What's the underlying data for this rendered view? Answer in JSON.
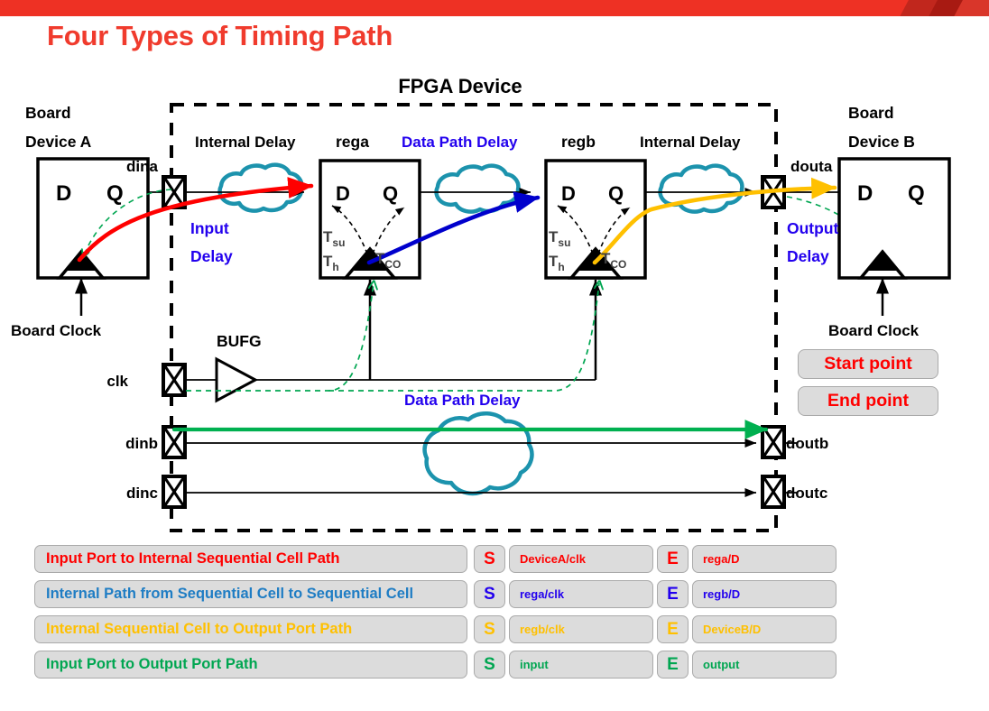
{
  "title": "Four Types of Timing Path",
  "colors": {
    "banner": "#EE3124",
    "title": "#F03B2D",
    "red_path": "#FF0000",
    "blue_path": "#0000CC",
    "amber_path": "#FFC000",
    "green_path": "#00B050",
    "clock_green": "#00A651",
    "cloud_teal": "#1C93AD",
    "label_blue": "#2200EE",
    "chip_bg": "#DCDCDC",
    "chip_border": "#AAAAAA"
  },
  "diagram": {
    "fpga_label": "FPGA Device",
    "left_board": {
      "line1": "Board",
      "line2": "Device A",
      "d": "D",
      "q": "Q",
      "clock": "Board Clock"
    },
    "right_board": {
      "line1": "Board",
      "line2": "Device B",
      "d": "D",
      "q": "Q",
      "clock": "Board Clock"
    },
    "pads": {
      "dina": "dina",
      "clk": "clk",
      "dinb": "dinb",
      "dinc": "dinc",
      "douta": "douta",
      "doutb": "doutb",
      "doutc": "doutc"
    },
    "registers": [
      {
        "name": "rega",
        "d": "D",
        "q": "Q",
        "tsu": "T",
        "tsu_sub": "su",
        "th": "T",
        "th_sub": "h",
        "tco": "T",
        "tco_sub": "CO"
      },
      {
        "name": "regb",
        "d": "D",
        "q": "Q",
        "tsu": "T",
        "tsu_sub": "su",
        "th": "T",
        "th_sub": "h",
        "tco": "T",
        "tco_sub": "CO"
      }
    ],
    "delays": {
      "internal_left": "Internal Delay",
      "internal_right": "Internal Delay",
      "data_path_top": "Data Path Delay",
      "data_path_bottom": "Data Path Delay",
      "input_delay_l1": "Input",
      "input_delay_l2": "Delay",
      "output_delay_l1": "Output",
      "output_delay_l2": "Delay"
    },
    "bufg": "BUFG",
    "start_point": "Start point",
    "end_point": "End point"
  },
  "legend": {
    "rows": [
      {
        "label": "Input Port to Internal Sequential Cell Path",
        "color": "#FF0000",
        "s": "S",
        "start": "DeviceA/clk",
        "e": "E",
        "end": "rega/D"
      },
      {
        "label": "Internal Path from Sequential Cell to Sequential Cell",
        "color": "#1F7DC4",
        "s": "S",
        "start": "rega/clk",
        "e": "E",
        "end": "regb/D",
        "value_color": "#2200EE"
      },
      {
        "label": "Internal Sequential Cell to Output Port Path",
        "color": "#FFC000",
        "s": "S",
        "start": "regb/clk",
        "e": "E",
        "end": "DeviceB/D"
      },
      {
        "label": "Input Port to Output Port Path",
        "color": "#00A651",
        "s": "S",
        "start": "input",
        "e": "E",
        "end": "output"
      }
    ]
  }
}
